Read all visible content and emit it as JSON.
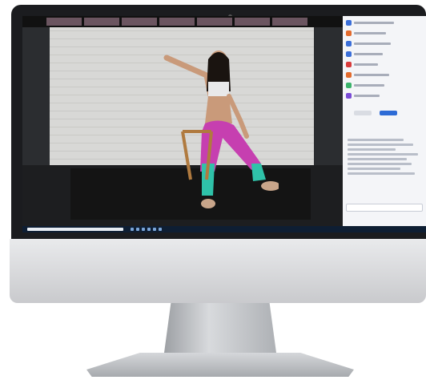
{
  "device": "desktop monitor",
  "video": {
    "participant_name": "",
    "thumbnails": 7
  },
  "panel": {
    "icon_colors": [
      "#3b6fd9",
      "#e36b2d",
      "#3b6fd9",
      "#3b6fd9",
      "#d83b3b",
      "#e36b2d",
      "#3bb36b",
      "#7a4bd6"
    ],
    "buttons": [
      "",
      ""
    ]
  },
  "colors": {
    "accent": "#2d6bd6",
    "taskbar": "#0e1e33"
  }
}
